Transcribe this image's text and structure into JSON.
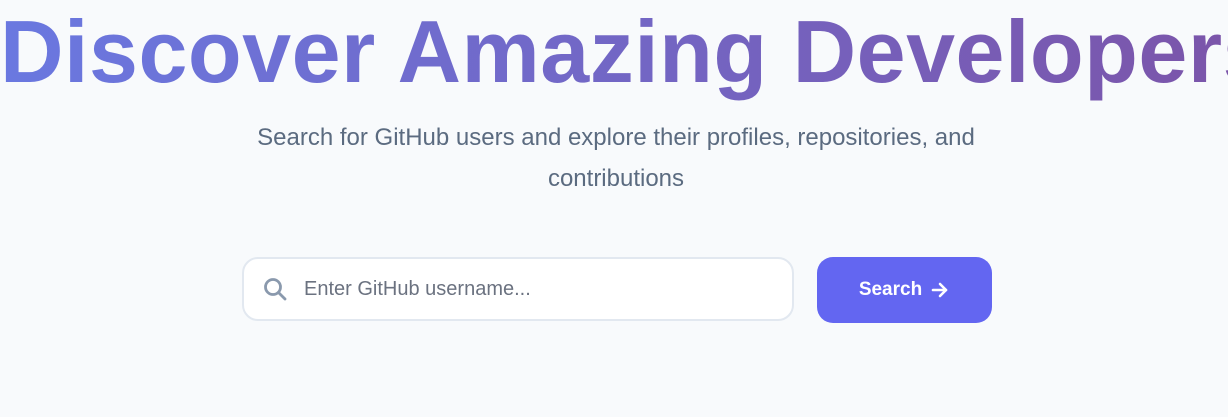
{
  "hero": {
    "title": "Discover Amazing Developers",
    "subtitle": "Search for GitHub users and explore their profiles, repositories, and contributions"
  },
  "search": {
    "placeholder": "Enter GitHub username...",
    "value": "",
    "button_label": "Search",
    "icon": "search-icon",
    "button_icon": "arrow-right-icon"
  },
  "colors": {
    "background": "#f8fafc",
    "title_gradient_start": "#6a78e0",
    "title_gradient_end": "#7b55aa",
    "subtitle": "#5b6b80",
    "button": "#6366f1",
    "input_border": "#e2e8f0"
  }
}
